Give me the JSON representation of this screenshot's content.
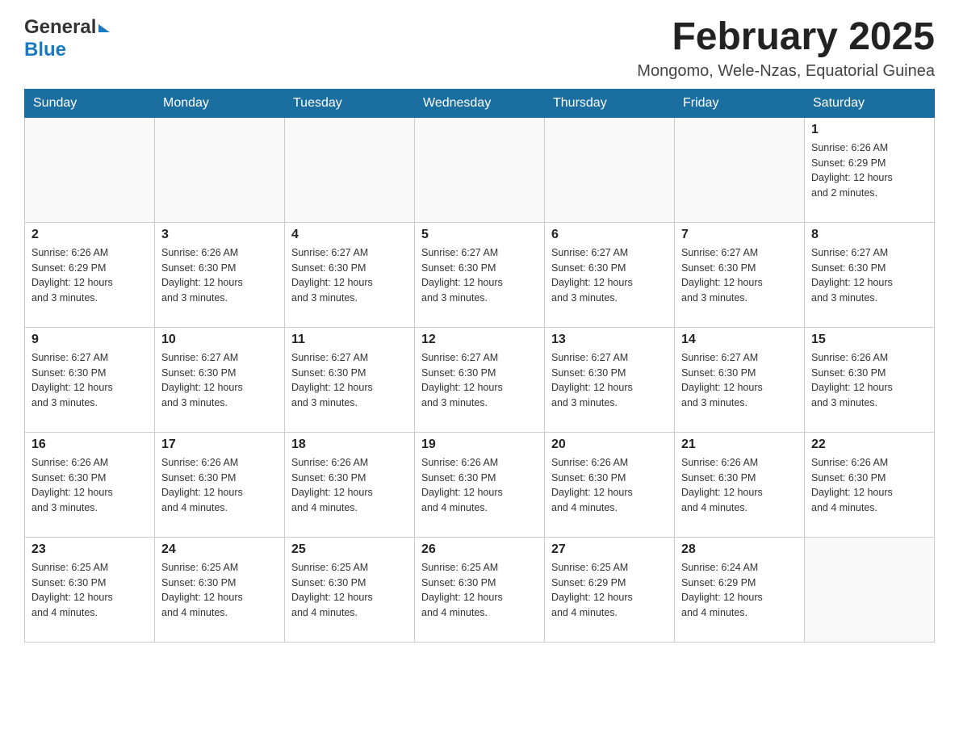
{
  "header": {
    "logo_general": "General",
    "logo_blue": "Blue",
    "title": "February 2025",
    "location": "Mongomo, Wele-Nzas, Equatorial Guinea"
  },
  "days_of_week": [
    "Sunday",
    "Monday",
    "Tuesday",
    "Wednesday",
    "Thursday",
    "Friday",
    "Saturday"
  ],
  "weeks": [
    {
      "days": [
        {
          "number": "",
          "info": ""
        },
        {
          "number": "",
          "info": ""
        },
        {
          "number": "",
          "info": ""
        },
        {
          "number": "",
          "info": ""
        },
        {
          "number": "",
          "info": ""
        },
        {
          "number": "",
          "info": ""
        },
        {
          "number": "1",
          "info": "Sunrise: 6:26 AM\nSunset: 6:29 PM\nDaylight: 12 hours\nand 2 minutes."
        }
      ]
    },
    {
      "days": [
        {
          "number": "2",
          "info": "Sunrise: 6:26 AM\nSunset: 6:29 PM\nDaylight: 12 hours\nand 3 minutes."
        },
        {
          "number": "3",
          "info": "Sunrise: 6:26 AM\nSunset: 6:30 PM\nDaylight: 12 hours\nand 3 minutes."
        },
        {
          "number": "4",
          "info": "Sunrise: 6:27 AM\nSunset: 6:30 PM\nDaylight: 12 hours\nand 3 minutes."
        },
        {
          "number": "5",
          "info": "Sunrise: 6:27 AM\nSunset: 6:30 PM\nDaylight: 12 hours\nand 3 minutes."
        },
        {
          "number": "6",
          "info": "Sunrise: 6:27 AM\nSunset: 6:30 PM\nDaylight: 12 hours\nand 3 minutes."
        },
        {
          "number": "7",
          "info": "Sunrise: 6:27 AM\nSunset: 6:30 PM\nDaylight: 12 hours\nand 3 minutes."
        },
        {
          "number": "8",
          "info": "Sunrise: 6:27 AM\nSunset: 6:30 PM\nDaylight: 12 hours\nand 3 minutes."
        }
      ]
    },
    {
      "days": [
        {
          "number": "9",
          "info": "Sunrise: 6:27 AM\nSunset: 6:30 PM\nDaylight: 12 hours\nand 3 minutes."
        },
        {
          "number": "10",
          "info": "Sunrise: 6:27 AM\nSunset: 6:30 PM\nDaylight: 12 hours\nand 3 minutes."
        },
        {
          "number": "11",
          "info": "Sunrise: 6:27 AM\nSunset: 6:30 PM\nDaylight: 12 hours\nand 3 minutes."
        },
        {
          "number": "12",
          "info": "Sunrise: 6:27 AM\nSunset: 6:30 PM\nDaylight: 12 hours\nand 3 minutes."
        },
        {
          "number": "13",
          "info": "Sunrise: 6:27 AM\nSunset: 6:30 PM\nDaylight: 12 hours\nand 3 minutes."
        },
        {
          "number": "14",
          "info": "Sunrise: 6:27 AM\nSunset: 6:30 PM\nDaylight: 12 hours\nand 3 minutes."
        },
        {
          "number": "15",
          "info": "Sunrise: 6:26 AM\nSunset: 6:30 PM\nDaylight: 12 hours\nand 3 minutes."
        }
      ]
    },
    {
      "days": [
        {
          "number": "16",
          "info": "Sunrise: 6:26 AM\nSunset: 6:30 PM\nDaylight: 12 hours\nand 3 minutes."
        },
        {
          "number": "17",
          "info": "Sunrise: 6:26 AM\nSunset: 6:30 PM\nDaylight: 12 hours\nand 4 minutes."
        },
        {
          "number": "18",
          "info": "Sunrise: 6:26 AM\nSunset: 6:30 PM\nDaylight: 12 hours\nand 4 minutes."
        },
        {
          "number": "19",
          "info": "Sunrise: 6:26 AM\nSunset: 6:30 PM\nDaylight: 12 hours\nand 4 minutes."
        },
        {
          "number": "20",
          "info": "Sunrise: 6:26 AM\nSunset: 6:30 PM\nDaylight: 12 hours\nand 4 minutes."
        },
        {
          "number": "21",
          "info": "Sunrise: 6:26 AM\nSunset: 6:30 PM\nDaylight: 12 hours\nand 4 minutes."
        },
        {
          "number": "22",
          "info": "Sunrise: 6:26 AM\nSunset: 6:30 PM\nDaylight: 12 hours\nand 4 minutes."
        }
      ]
    },
    {
      "days": [
        {
          "number": "23",
          "info": "Sunrise: 6:25 AM\nSunset: 6:30 PM\nDaylight: 12 hours\nand 4 minutes."
        },
        {
          "number": "24",
          "info": "Sunrise: 6:25 AM\nSunset: 6:30 PM\nDaylight: 12 hours\nand 4 minutes."
        },
        {
          "number": "25",
          "info": "Sunrise: 6:25 AM\nSunset: 6:30 PM\nDaylight: 12 hours\nand 4 minutes."
        },
        {
          "number": "26",
          "info": "Sunrise: 6:25 AM\nSunset: 6:30 PM\nDaylight: 12 hours\nand 4 minutes."
        },
        {
          "number": "27",
          "info": "Sunrise: 6:25 AM\nSunset: 6:29 PM\nDaylight: 12 hours\nand 4 minutes."
        },
        {
          "number": "28",
          "info": "Sunrise: 6:24 AM\nSunset: 6:29 PM\nDaylight: 12 hours\nand 4 minutes."
        },
        {
          "number": "",
          "info": ""
        }
      ]
    }
  ]
}
